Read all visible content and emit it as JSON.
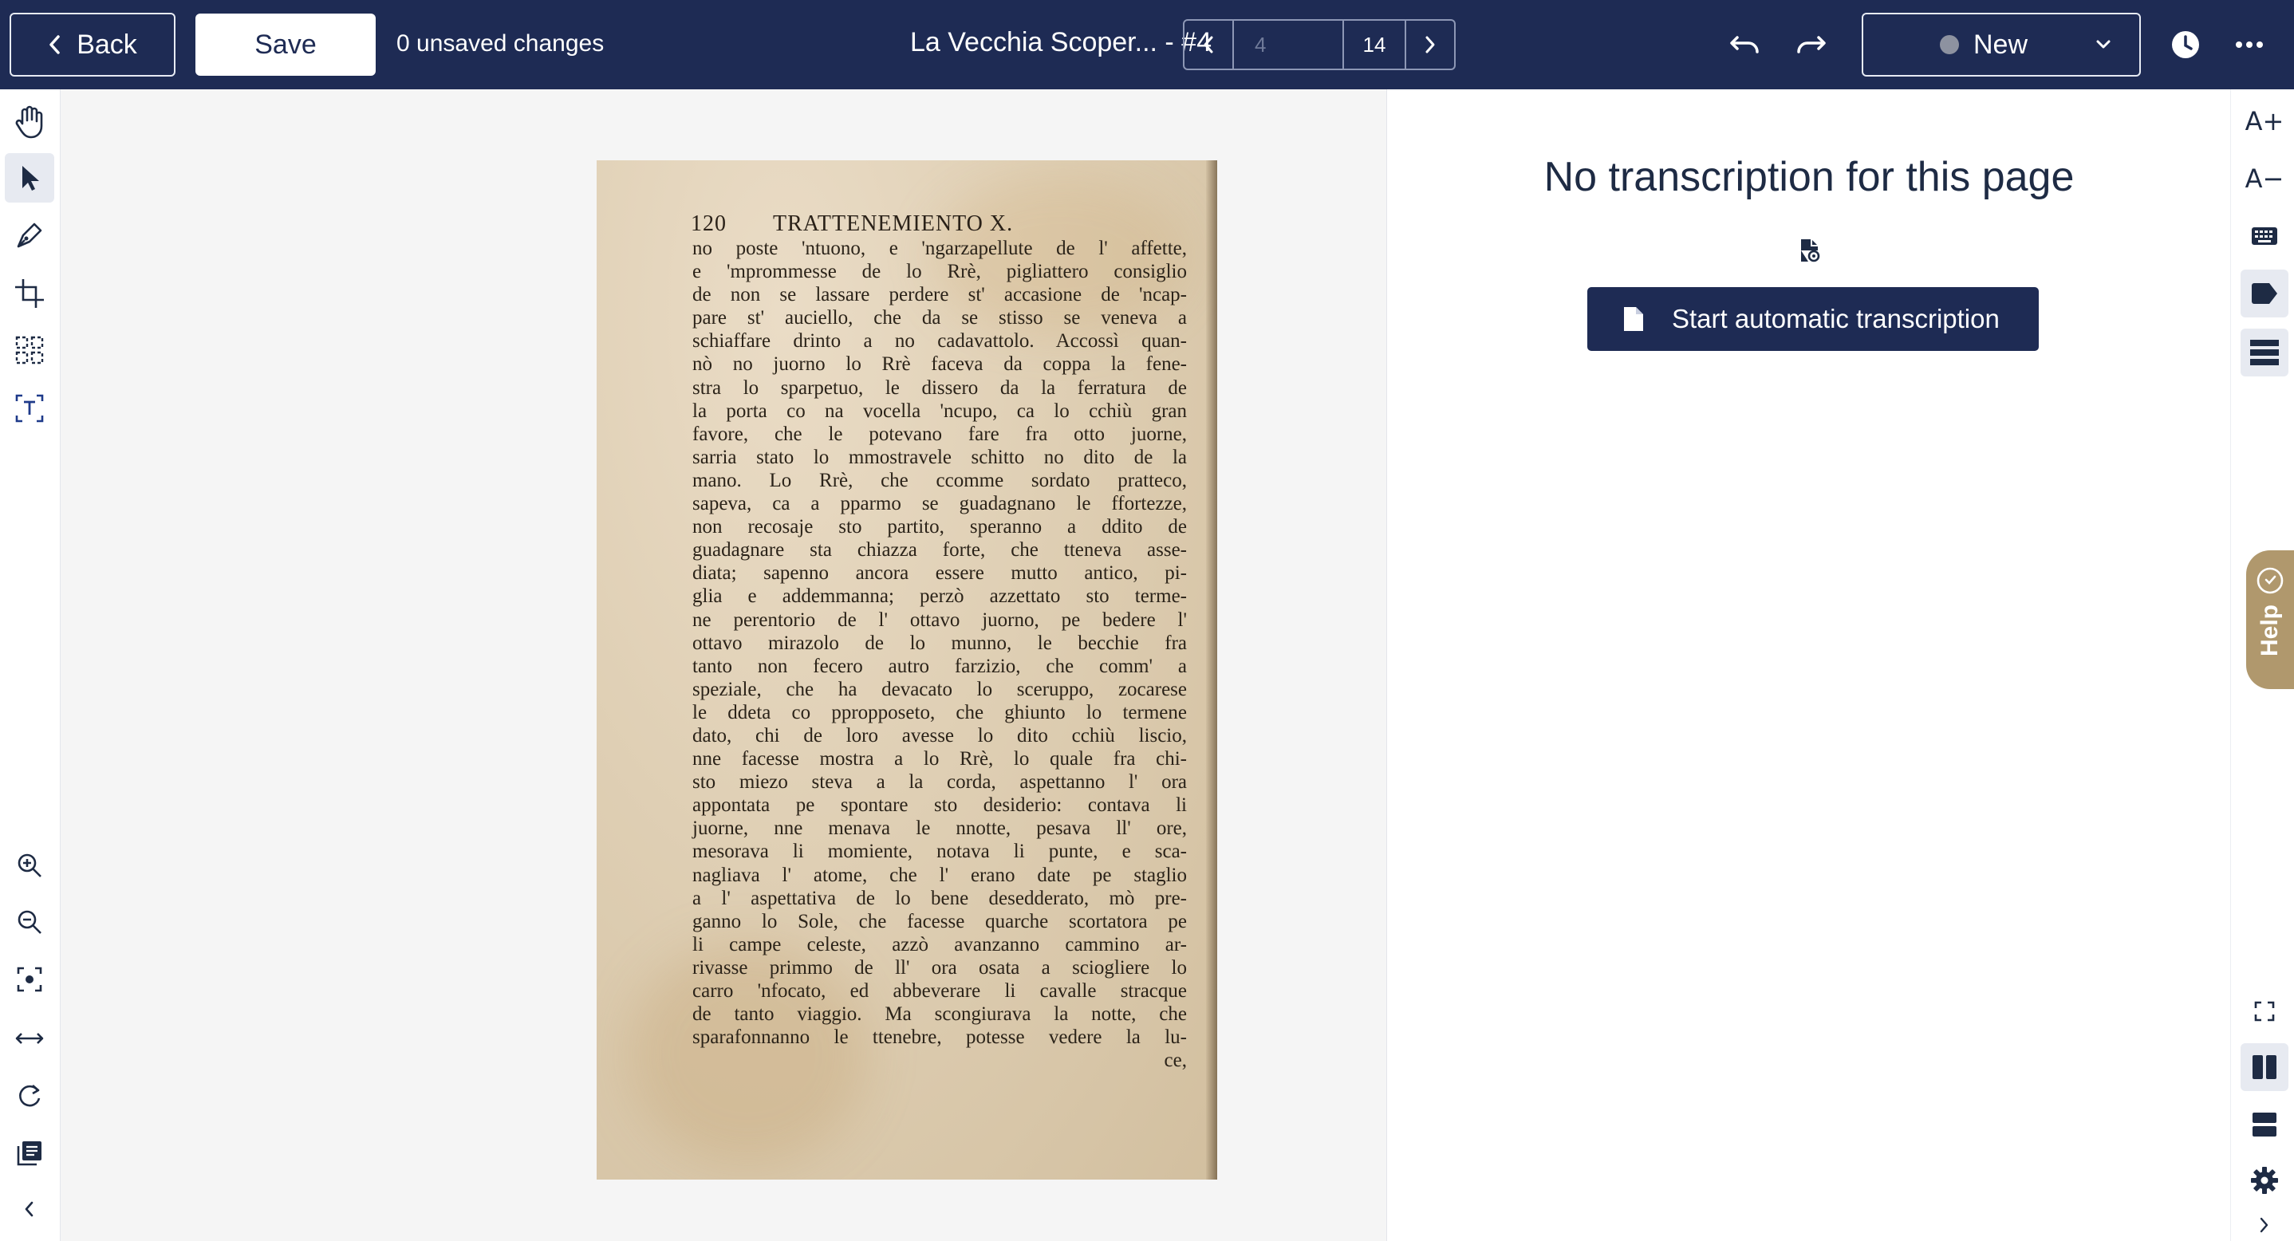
{
  "topbar": {
    "back_label": "Back",
    "save_label": "Save",
    "unsaved_text": "0 unsaved changes",
    "document_title": "La Vecchia Scoper... - #4",
    "page_input_placeholder": "4",
    "page_total": "14",
    "status_label": "New",
    "icons": [
      "chevron-left-icon",
      "undo-icon",
      "redo-icon",
      "chevron-down-icon",
      "history-icon",
      "more-icon"
    ]
  },
  "left_tools": [
    "pan-icon",
    "select-icon",
    "draw-icon",
    "crop-icon",
    "layout-icon",
    "text-select-icon",
    "zoom-in-icon",
    "zoom-out-icon",
    "fit-icon",
    "fit-width-icon",
    "rotate-icon",
    "pages-icon",
    "collapse-icon"
  ],
  "page_image": {
    "header_page_number": "120",
    "header_title": "TRATTENEMIENTO X.",
    "lines": [
      "no poste 'ntuono, e 'ngarzapellute de l' affette,",
      "e 'mprommesse de lo Rrè, pigliattero consiglio",
      "de non se lassare perdere st' accasione de 'ncap-",
      "pare st' auciello, che da se stisso se veneva a",
      "schiaffare drinto a no cadavattolo. Accossì quan-",
      "nò no juorno lo Rrè faceva da coppa la fene-",
      "stra lo sparpetuo, le dissero da la ferratura de",
      "la porta co na vocella 'ncupo, ca lo cchiù gran",
      "favore, che le potevano fare fra otto juorne,",
      "sarria stato lo mmostravele schitto no dito de la",
      "mano. Lo Rrè, che ccomme sordato pratteco,",
      "sapeva, ca a pparmo se guadagnano le ffortezze,",
      "non recosaje sto partito, speranno a ddito de",
      "guadagnare sta chiazza forte, che tteneva asse-",
      "diata; sapenno ancora essere mutto antico, pi-",
      "glia e addemmanna; perzò azzettato sto terme-",
      "ne perentorio de l' ottavo juorno, pe bedere l'",
      "ottavo mirazolo de lo munno, le becchie fra",
      "tanto non fecero autro farzizio, che comm' a",
      "speziale, che ha devacato lo sceruppo, zocarese",
      "le ddeta co ppropposeto, che ghiunto lo termene",
      "dato, chi de loro avesse lo dito cchiù liscio,",
      "nne facesse mostra a lo Rrè, lo quale fra chi-",
      "sto miezo steva a la corda, aspettanno l' ora",
      "appontata pe spontare sto desiderio: contava li",
      "juorne, nne menava le nnotte, pesava ll' ore,",
      "mesorava li momiente, notava li punte, e sca-",
      "nagliava l' atome, che l' erano date pe staglio",
      "a l' aspettativa de lo bene desedderato, mò pre-",
      "ganno lo Sole, che facesse quarche scortatora pe",
      "li campe celeste, azzò avanzanno cammino ar-",
      "rivasse primmo de ll' ora osata a sciogliere lo",
      "carro 'nfocato, ed abbeverare li cavalle stracque",
      "de tanto viaggio. Ma scongiurava la notte, che",
      "sparafonnanno le ttenebre, potesse vedere la lu-",
      "ce,"
    ]
  },
  "panel": {
    "no_transcription": "No transcription for this page",
    "start_button": "Start automatic transcription"
  },
  "right_rail": {
    "font_increase": "A+",
    "font_decrease": "A−",
    "help_label": "Help"
  },
  "colors": {
    "topbar_bg": "#1e2b54",
    "primary_button": "#1e2b54",
    "help_tab": "#b0986d",
    "status_dot": "#8d92a0"
  }
}
